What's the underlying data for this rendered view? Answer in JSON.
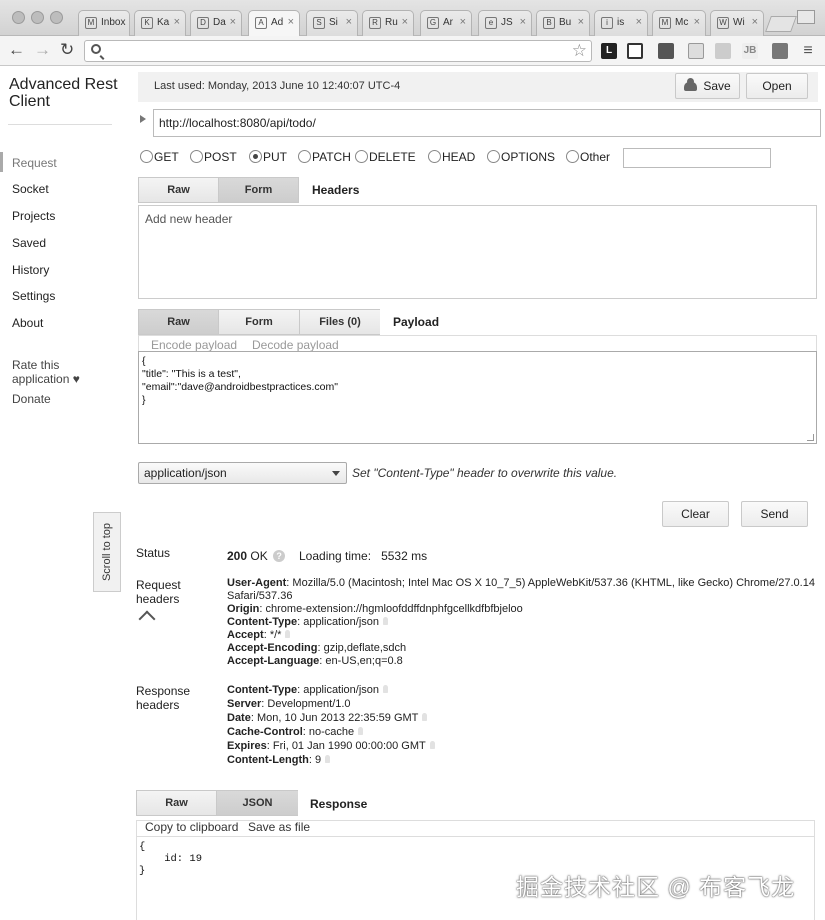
{
  "browser": {
    "tabs": [
      {
        "label": "Inbox",
        "icon": "M"
      },
      {
        "label": "Ka",
        "icon": "K"
      },
      {
        "label": "Da",
        "icon": "D"
      },
      {
        "label": "Ad",
        "icon": "A"
      },
      {
        "label": "Si",
        "icon": "S"
      },
      {
        "label": "Ru",
        "icon": "R"
      },
      {
        "label": "Ar",
        "icon": "G"
      },
      {
        "label": "JS",
        "icon": "e"
      },
      {
        "label": "Bu",
        "icon": "B"
      },
      {
        "label": "is",
        "icon": "i"
      },
      {
        "label": "Mc",
        "icon": "M"
      },
      {
        "label": "Wi",
        "icon": "W"
      }
    ],
    "address": ""
  },
  "app": {
    "title": "Advanced Rest Client"
  },
  "sidebar": {
    "items": [
      "Request",
      "Socket",
      "Projects",
      "Saved",
      "History",
      "Settings",
      "About"
    ],
    "rate": "Rate this application ♥",
    "donate": "Donate"
  },
  "header": {
    "last_used": "Last used: Monday, 2013 June 10 12:40:07 UTC-4",
    "save_label": "Save",
    "open_label": "Open"
  },
  "request": {
    "url": "http://localhost:8080/api/todo/",
    "methods": [
      "GET",
      "POST",
      "PUT",
      "PATCH",
      "DELETE",
      "HEAD",
      "OPTIONS",
      "Other"
    ],
    "selected_method": "PUT",
    "headers_tabs": [
      "Raw",
      "Form"
    ],
    "headers_title": "Headers",
    "headers_placeholder": "Add new header",
    "payload_tabs": [
      "Raw",
      "Form",
      "Files (0)"
    ],
    "payload_title": "Payload",
    "encode_label": "Encode payload",
    "decode_label": "Decode payload",
    "payload_lines": [
      "{",
      "\"title\": \"This is a test\",",
      "\"email\":\"dave@androidbestpractices.com\"",
      "}"
    ],
    "content_type": "application/json",
    "content_type_hint": "Set \"Content-Type\" header to overwrite this value.",
    "clear_label": "Clear",
    "send_label": "Send"
  },
  "scroll_to_top": "Scroll to top",
  "response": {
    "status_label": "Status",
    "status_code": "200",
    "status_text": "OK",
    "loading_label": "Loading time:",
    "loading_value": "5532 ms",
    "request_headers_label": "Request\nheaders",
    "request_headers": [
      {
        "name": "User-Agent",
        "value": "Mozilla/5.0 (Macintosh; Intel Mac OS X 10_7_5) AppleWebKit/537.36 (KHTML, like Gecko) Chrome/27.0.14"
      },
      {
        "name": "",
        "value": "Safari/537.36"
      },
      {
        "name": "Origin",
        "value": "chrome-extension://hgmloofddffdnphfgcellkdfbfbjeloo"
      },
      {
        "name": "Content-Type",
        "value": "application/json"
      },
      {
        "name": "Accept",
        "value": "*/*"
      },
      {
        "name": "Accept-Encoding",
        "value": "gzip,deflate,sdch"
      },
      {
        "name": "Accept-Language",
        "value": "en-US,en;q=0.8"
      }
    ],
    "response_headers_label": "Response\nheaders",
    "response_headers": [
      {
        "name": "Content-Type",
        "value": "application/json"
      },
      {
        "name": "Server",
        "value": "Development/1.0"
      },
      {
        "name": "Date",
        "value": "Mon, 10 Jun 2013 22:35:59 GMT"
      },
      {
        "name": "Cache-Control",
        "value": "no-cache"
      },
      {
        "name": "Expires",
        "value": "Fri, 01 Jan 1990 00:00:00 GMT"
      },
      {
        "name": "Content-Length",
        "value": "9"
      }
    ],
    "body_tabs": [
      "Raw",
      "JSON"
    ],
    "body_title": "Response",
    "copy_label": "Copy to clipboard",
    "save_file_label": "Save as file",
    "body_lines": [
      "{",
      "    id: 19",
      "}"
    ]
  },
  "watermark": "掘金技术社区 @ 布客飞龙"
}
